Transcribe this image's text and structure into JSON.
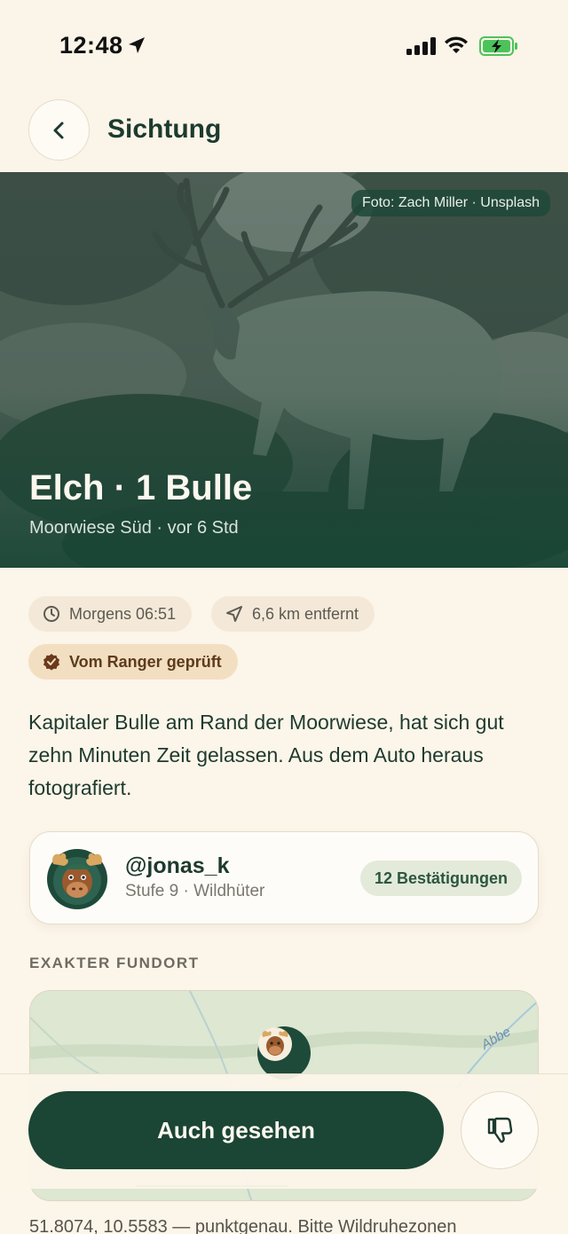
{
  "status_bar": {
    "time": "12:48"
  },
  "nav": {
    "title": "Sichtung"
  },
  "hero": {
    "credit": "Foto: Zach Miller · Unsplash",
    "title": "Elch · 1 Bulle",
    "subtitle": "Moorwiese Süd · vor 6 Std"
  },
  "chips": {
    "time": "Morgens 06:51",
    "distance": "6,6 km entfernt",
    "ranger": "Vom Ranger geprüft"
  },
  "description": "Kapitaler Bulle am Rand der Moorwiese, hat sich gut zehn Minuten Zeit gelassen. Aus dem Auto heraus fotografiert.",
  "user": {
    "handle": "@jonas_k",
    "level": "Stufe 9 · Wildhüter",
    "confirmations": "12 Bestätigungen"
  },
  "location": {
    "section_label": "EXAKTER FUNDORT",
    "map_label": "Abbe",
    "coords": "51.8074, 10.5583 — punktgenau. Bitte Wildruhezonen"
  },
  "actions": {
    "primary": "Auch gesehen"
  },
  "colors": {
    "background": "#fcf5e9",
    "primary": "#1b4535",
    "ranger_badge": "#f2dfc2",
    "confirm_badge": "#e3ead9"
  }
}
